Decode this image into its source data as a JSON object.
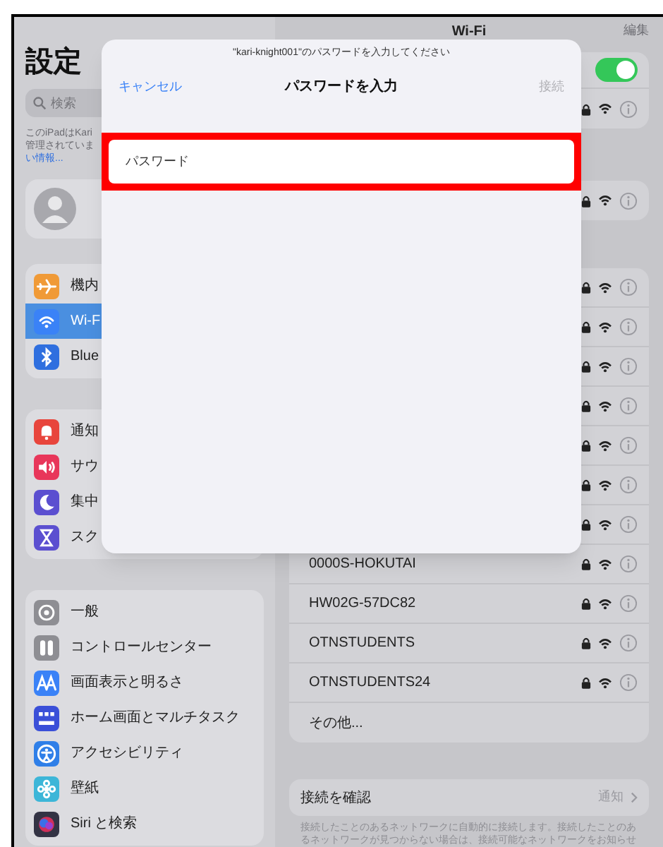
{
  "sidebar": {
    "title": "設定",
    "search": {
      "placeholder": "検索"
    },
    "notice_lines": [
      {
        "text": "このiPadはKari",
        "link": false
      },
      {
        "text": "管理されていま",
        "link": false
      },
      {
        "text": "い情報...",
        "link": true
      }
    ],
    "groups": [
      [
        {
          "label": "機内",
          "kind": "airplane",
          "color": "#f09a37",
          "selected": false
        },
        {
          "label": "Wi-F",
          "kind": "wifi",
          "color": "#3a82f7",
          "selected": true
        },
        {
          "label": "Blue",
          "kind": "bluetooth",
          "color": "#2f6fdf",
          "selected": false
        }
      ],
      [
        {
          "label": "通知",
          "kind": "bell",
          "color": "#e8453c",
          "selected": false
        },
        {
          "label": "サウ",
          "kind": "speaker",
          "color": "#e8365a",
          "selected": false
        },
        {
          "label": "集中",
          "kind": "moon",
          "color": "#5b4fd0",
          "selected": false
        },
        {
          "label": "スク",
          "kind": "hourglass",
          "color": "#5b4fd0",
          "selected": false
        }
      ],
      [
        {
          "label": "一般",
          "kind": "gear",
          "color": "#8e8e93",
          "selected": false
        },
        {
          "label": "コントロールセンター",
          "kind": "switches",
          "color": "#8e8e93",
          "selected": false
        },
        {
          "label": "画面表示と明るさ",
          "kind": "display",
          "color": "#3a82f7",
          "selected": false
        },
        {
          "label": "ホーム画面とマルチタスク",
          "kind": "grid",
          "color": "#3a4fd8",
          "selected": false
        },
        {
          "label": "アクセシビリティ",
          "kind": "accessibility",
          "color": "#2f7fe8",
          "selected": false
        },
        {
          "label": "壁紙",
          "kind": "flower",
          "color": "#3db6d8",
          "selected": false
        },
        {
          "label": "Siri と検索",
          "kind": "siri",
          "color": "#333344",
          "selected": false
        }
      ]
    ]
  },
  "wifi": {
    "title": "Wi-Fi",
    "edit": "編集",
    "enabled": true,
    "connected": [
      {
        "locked": true
      }
    ],
    "saved": [
      {
        "locked": true
      }
    ],
    "networks": [
      {
        "locked": true
      },
      {
        "locked": true
      },
      {
        "locked": true
      },
      {
        "locked": true
      },
      {
        "locked": true
      },
      {
        "locked": true
      },
      {
        "locked": true
      },
      {
        "name": "0000S-HOKUTAI",
        "locked": true
      },
      {
        "name": "HW02G-57DC82",
        "locked": true
      },
      {
        "name": "OTNSTUDENTS",
        "locked": true
      },
      {
        "name": "OTNSTUDENTS24",
        "locked": true
      },
      {
        "name": "その他..."
      }
    ],
    "ask": {
      "label": "接続を確認",
      "value": "通知",
      "note": "接続したことのあるネットワークに自動的に接続します。接続したことのあるネットワークが見つからない場合は、接続可能なネットワークをお知らせ"
    }
  },
  "modal": {
    "prompt": "\"kari-knight001\"のパスワードを入力してください",
    "cancel": "キャンセル",
    "title": "パスワードを入力",
    "connect": {
      "label": "接続",
      "disabled": true
    },
    "password": {
      "placeholder": "パスワード",
      "highlighted": true
    }
  }
}
